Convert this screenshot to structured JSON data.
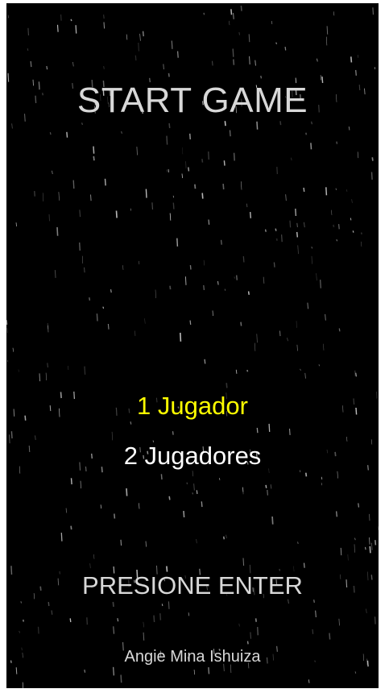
{
  "game": {
    "title": "START GAME",
    "menu": {
      "options": [
        {
          "label": "1 Jugador",
          "selected": true
        },
        {
          "label": "2 Jugadores",
          "selected": false
        }
      ],
      "selected_color": "#ffff00",
      "default_color": "#ffffff"
    },
    "prompt": "PRESIONE ENTER",
    "credit": "Angie Mina Ishuiza"
  },
  "colors": {
    "background": "#000000",
    "text": "#d8d8d8",
    "star": "#ffffff"
  }
}
